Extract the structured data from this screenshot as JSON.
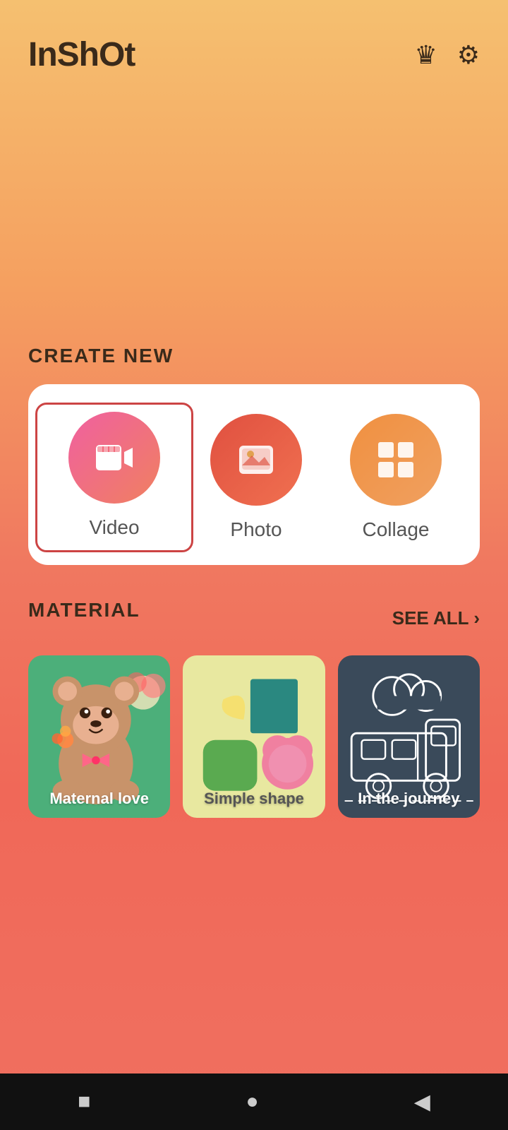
{
  "app": {
    "title": "InShOt"
  },
  "header": {
    "crown_icon": "♛",
    "settings_icon": "⚙"
  },
  "create_new": {
    "section_title": "CREATE NEW",
    "items": [
      {
        "id": "video",
        "label": "Video",
        "selected": true
      },
      {
        "id": "photo",
        "label": "Photo",
        "selected": false
      },
      {
        "id": "collage",
        "label": "Collage",
        "selected": false
      }
    ]
  },
  "material": {
    "section_title": "MATERIAL",
    "see_all_label": "SEE ALL",
    "items": [
      {
        "id": "maternal",
        "label": "Maternal love"
      },
      {
        "id": "simple",
        "label": "Simple shape"
      },
      {
        "id": "journey",
        "label": "In the journey"
      }
    ]
  },
  "navbar": {
    "square_icon": "■",
    "circle_icon": "●",
    "back_icon": "◀"
  }
}
